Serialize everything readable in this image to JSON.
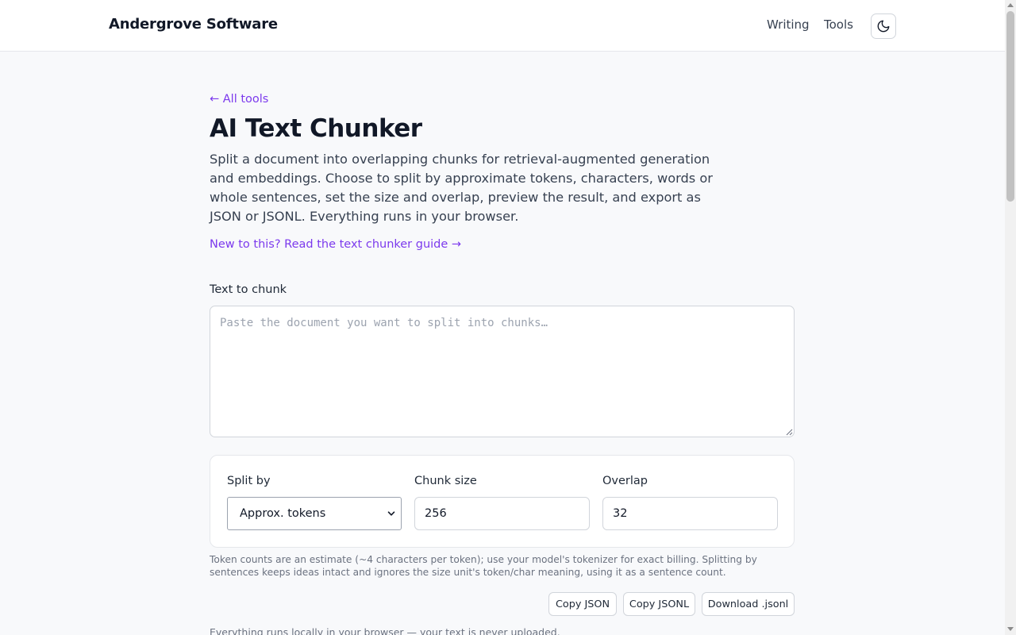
{
  "header": {
    "brand": "Andergrove Software",
    "nav": [
      {
        "label": "Writing"
      },
      {
        "label": "Tools"
      }
    ],
    "theme_toggle_icon": "moon-icon"
  },
  "main": {
    "back_link": "← All tools",
    "title": "AI Text Chunker",
    "description": "Split a document into overlapping chunks for retrieval-augmented generation and embeddings. Choose to split by approximate tokens, characters, words or whole sentences, set the size and overlap, preview the result, and export as JSON or JSONL. Everything runs in your browser.",
    "guide_link": "New to this? Read the text chunker guide →",
    "text_label": "Text to chunk",
    "text_placeholder": "Paste the document you want to split into chunks…",
    "text_value": "",
    "options": {
      "split_by_label": "Split by",
      "split_by_value": "Approx. tokens",
      "chunk_size_label": "Chunk size",
      "chunk_size_value": "256",
      "overlap_label": "Overlap",
      "overlap_value": "32"
    },
    "help_text": "Token counts are an estimate (~4 characters per token); use your model's tokenizer for exact billing. Splitting by sentences keeps ideas intact and ignores the size unit's token/char meaning, using it as a sentence count.",
    "actions": {
      "copy_json": "Copy JSON",
      "copy_jsonl": "Copy JSONL",
      "download_jsonl": "Download .jsonl"
    },
    "footer_note": "Everything runs locally in your browser — your text is never uploaded."
  },
  "colors": {
    "accent": "#7c3aed",
    "background": "#f8f9fb",
    "text": "#111827"
  }
}
